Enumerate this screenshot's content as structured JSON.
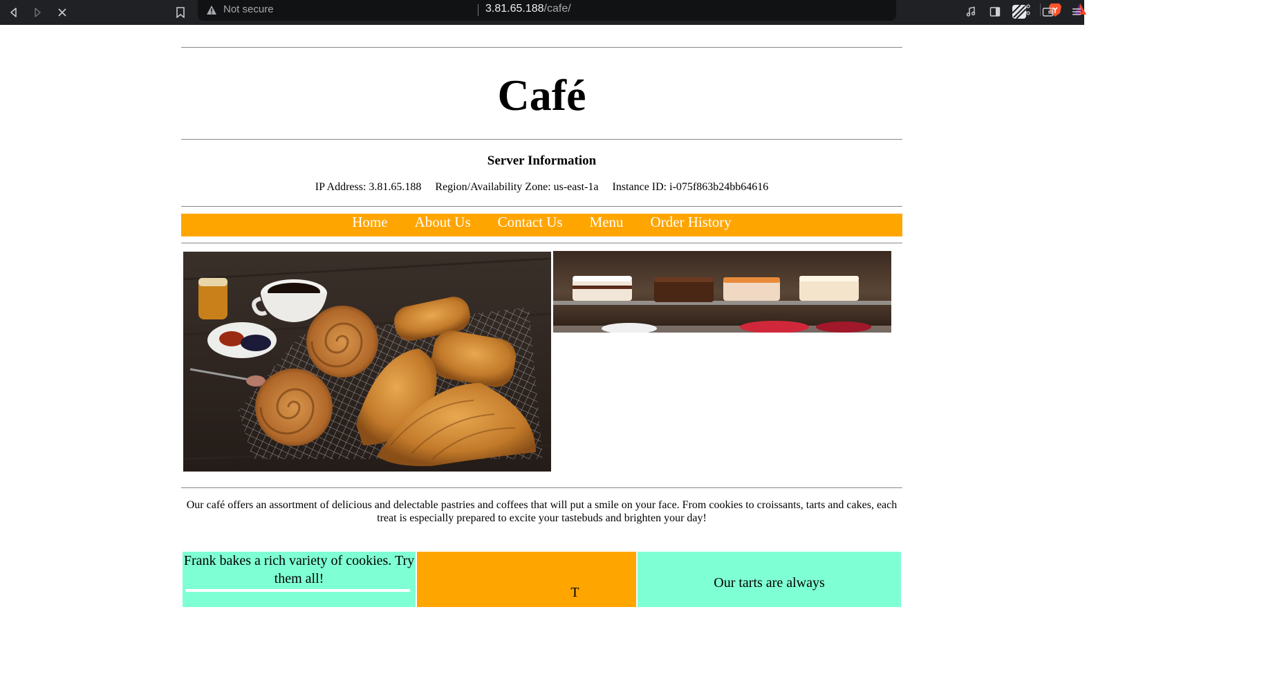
{
  "browser": {
    "security_label": "Not secure",
    "url_host": "3.81.65.188",
    "url_path": "/cafe/"
  },
  "site": {
    "title": "Café"
  },
  "server_info": {
    "heading": "Server Information",
    "line": "IP Address: 3.81.65.188     Region/Availability Zone: us-east-1a     Instance ID: i-075f863b24bb64616"
  },
  "nav": {
    "items": [
      "Home",
      "About Us",
      "Contact Us",
      "Menu",
      "Order History"
    ]
  },
  "intro": {
    "text": "Our café offers an assortment of delicious and delectable pastries and coffees that will put a smile on your face. From cookies to croissants, tarts and cakes, each treat is especially prepared to excite your tastebuds and brighten your day!"
  },
  "features": {
    "cookies": "Frank bakes a rich variety of cookies. Try them all!",
    "middle": "T",
    "tarts": "Our tarts are always"
  },
  "colors": {
    "nav_bg": "#ffa500",
    "feature_aqua": "#7fffd4",
    "feature_orange": "#ffa500",
    "chrome_bg": "#202124"
  }
}
